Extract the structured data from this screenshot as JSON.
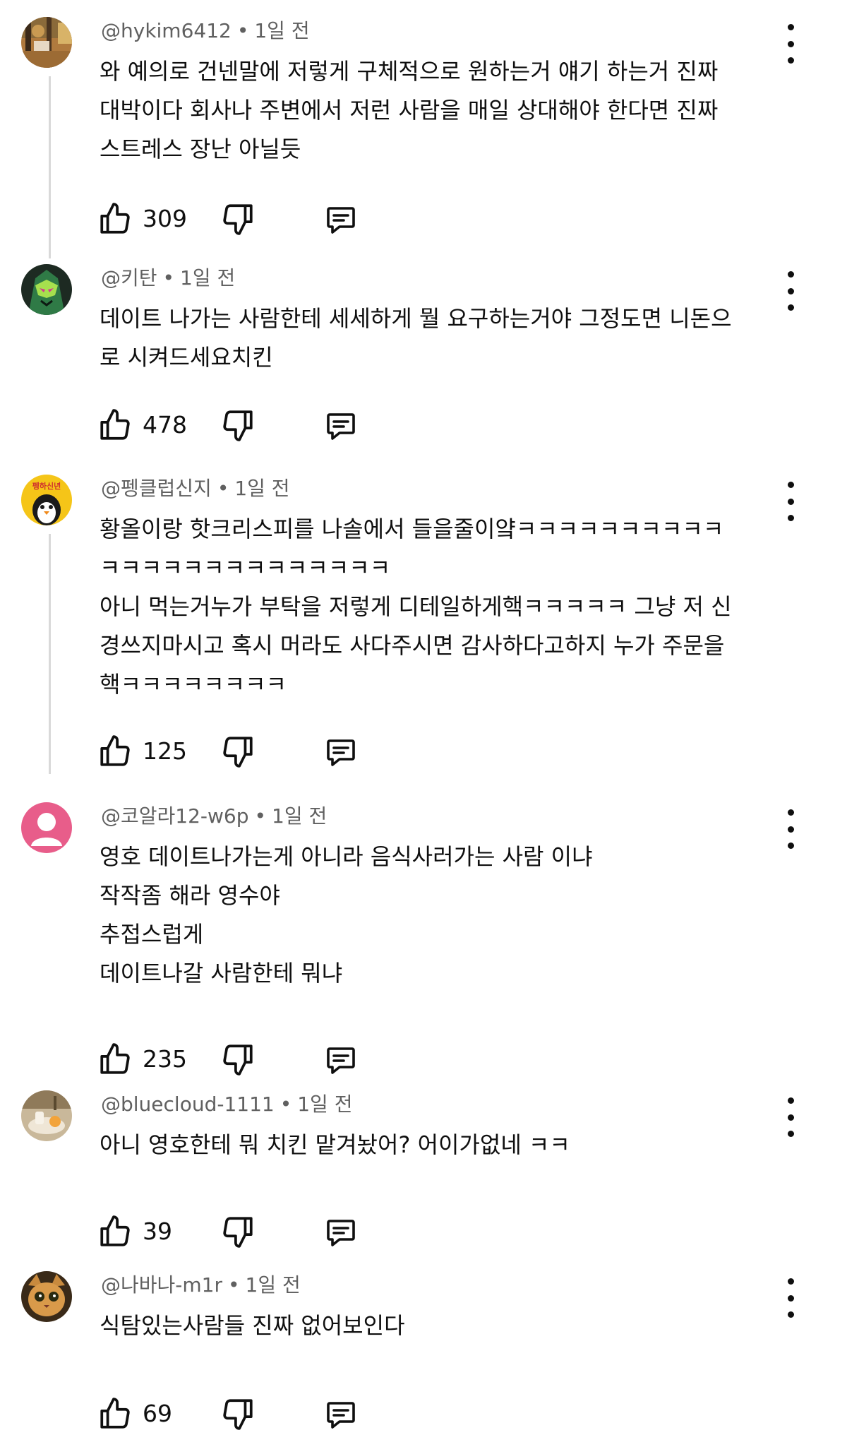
{
  "comments": [
    {
      "username": "@hykim6412",
      "time": "1일 전",
      "lines": [
        "와 예의로 건넨말에 저렇게 구체적으로 원하는거 얘기 하는거 진짜",
        "대박이다 회사나 주변에서 저런 사람을 매일 상대해야 한다면 진짜",
        "스트레스 장난 아닐듯"
      ],
      "likes": "309",
      "avatar": "autumn-forest-photo"
    },
    {
      "username": "@키탄",
      "time": "1일 전",
      "lines": [
        "데이트 나가는 사람한테 세세하게 뭘 요구하는거야 그정도면 니돈으",
        "로 시켜드세요치킨"
      ],
      "likes": "478",
      "avatar": "green-masked-character"
    },
    {
      "username": "@펭클럽신지",
      "time": "1일 전",
      "lines": [
        "황올이랑 핫크리스피를 나솔에서 들을줄이얔ㅋㅋㅋㅋㅋㅋㅋㅋㅋㅋ",
        "ㅋㅋㅋㅋㅋㅋㅋㅋㅋㅋㅋㅋㅋㅋ",
        "아니 먹는거누가 부탁을 저렇게 디테일하게핵ㅋㅋㅋㅋㅋ 그냥 저 신",
        "경쓰지마시고 혹시 머라도 사다주시면 감사하다고하지 누가 주문을",
        "핵ㅋㅋㅋㅋㅋㅋㅋㅋ"
      ],
      "likes": "125",
      "avatar": "penguin-character",
      "avatar_text": "펭하신년"
    },
    {
      "username": "@코알라12-w6p",
      "time": "1일 전",
      "lines": [
        "영호 데이트나가는게 아니라 음식사러가는 사람 이냐",
        "작작좀 해라 영수야",
        "추접스럽게",
        "데이트나갈 사람한테 뭐냐"
      ],
      "likes": "235",
      "avatar": "default-user-avatar",
      "avatar_color": "#e85d8a"
    },
    {
      "username": "@bluecloud-1111",
      "time": "1일 전",
      "lines": [
        "아니 영호한테 뭐 치킨 맡겨놨어? 어이가없네 ㅋㅋ"
      ],
      "likes": "39",
      "avatar": "cafe-table-photo"
    },
    {
      "username": "@나바나-m1r",
      "time": "1일 전",
      "lines": [
        "식탐있는사람들 진짜 없어보인다"
      ],
      "likes": "69",
      "avatar": "cat-face-photo"
    }
  ],
  "icons": {
    "like": "thumbs-up-icon",
    "dislike": "thumbs-down-icon",
    "reply": "reply-comment-icon",
    "more": "more-vertical-icon"
  }
}
